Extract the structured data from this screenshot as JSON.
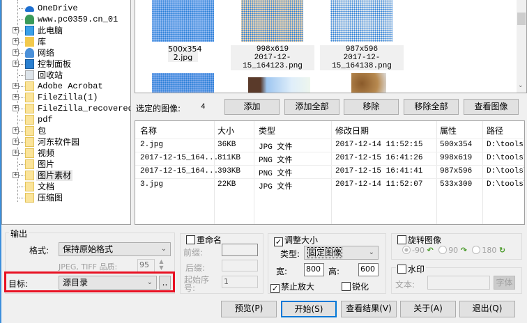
{
  "tree": [
    {
      "label": "OneDrive",
      "expandable": false,
      "icon": "onedrive-icon"
    },
    {
      "label": "www.pc0359.cn_01",
      "expandable": false,
      "icon": "user-icon"
    },
    {
      "label": "此电脑",
      "expandable": true,
      "icon": "computer-icon"
    },
    {
      "label": "库",
      "expandable": true,
      "icon": "library-icon"
    },
    {
      "label": "网络",
      "expandable": true,
      "icon": "network-icon"
    },
    {
      "label": "控制面板",
      "expandable": true,
      "icon": "control-panel-icon"
    },
    {
      "label": "回收站",
      "expandable": false,
      "icon": "recycle-bin-icon"
    },
    {
      "label": "Adobe Acrobat",
      "expandable": true,
      "icon": "folder-icon"
    },
    {
      "label": "FileZilla(1)",
      "expandable": true,
      "icon": "folder-icon"
    },
    {
      "label": "FileZilla_recovered",
      "expandable": true,
      "icon": "folder-icon"
    },
    {
      "label": "pdf",
      "expandable": false,
      "icon": "folder-icon"
    },
    {
      "label": "包",
      "expandable": true,
      "icon": "folder-icon"
    },
    {
      "label": "河东软件园",
      "expandable": true,
      "icon": "folder-icon"
    },
    {
      "label": "视频",
      "expandable": true,
      "icon": "folder-icon"
    },
    {
      "label": "图片",
      "expandable": false,
      "icon": "folder-icon"
    },
    {
      "label": "图片素材",
      "expandable": true,
      "icon": "folder-icon",
      "selected": true
    },
    {
      "label": "文档",
      "expandable": false,
      "icon": "folder-icon"
    },
    {
      "label": "压缩图",
      "expandable": false,
      "icon": "folder-icon"
    }
  ],
  "thumbnails": [
    {
      "size": "500x354",
      "name": "2.jpg"
    },
    {
      "size": "998x619",
      "name": "2017-12-15_164123.png"
    },
    {
      "size": "987x596",
      "name": "2017-12-15_164138.png"
    }
  ],
  "selection": {
    "label": "选定的图像:",
    "count": "4"
  },
  "actions": {
    "add": "添加",
    "add_all": "添加全部",
    "remove": "移除",
    "remove_all": "移除全部",
    "view": "查看图像"
  },
  "list": {
    "headers": [
      "名称",
      "大小",
      "类型",
      "修改日期",
      "属性",
      "路径"
    ],
    "rows": [
      [
        "2.jpg",
        "36KB",
        "JPG 文件",
        "2017-12-14 11:52:15",
        "500x354",
        "D:\\tools\\"
      ],
      [
        "2017-12-15_164...",
        "811KB",
        "PNG 文件",
        "2017-12-15 16:41:26",
        "998x619",
        "D:\\tools\\"
      ],
      [
        "2017-12-15_164...",
        "393KB",
        "PNG 文件",
        "2017-12-15 16:41:41",
        "987x596",
        "D:\\tools\\"
      ],
      [
        "3.jpg",
        "22KB",
        "JPG 文件",
        "2017-12-14 11:52:07",
        "533x300",
        "D:\\tools\\"
      ]
    ]
  },
  "output": {
    "title": "输出",
    "format_label": "格式:",
    "format_value": "保持原始格式",
    "quality_label": "JPEG, TIFF 品质:",
    "quality_value": "95",
    "target_label": "目标:",
    "target_value": "源目录",
    "browse": ".."
  },
  "rename": {
    "title": "重命名",
    "prefix": "前缀:",
    "suffix": "后缀:",
    "start": "起始序号:",
    "start_value": "1"
  },
  "resize": {
    "title": "调整大小",
    "type_label": "类型:",
    "type_value": "固定图像",
    "width_label": "宽:",
    "width_value": "800",
    "height_label": "高:",
    "height_value": "600",
    "no_enlarge": "禁止放大",
    "sharpen": "锐化"
  },
  "rotate": {
    "title": "旋转图像",
    "opts": [
      "-90",
      "90",
      "180"
    ]
  },
  "watermark": {
    "title": "水印",
    "text_label": "文本:",
    "font_btn": "字体"
  },
  "footer": {
    "preview": "预览(P)",
    "start": "开始(S)",
    "results": "查看结果(V)",
    "about": "关于(A)",
    "exit": "退出(Q)"
  },
  "colors": {
    "highlight": "#e81123",
    "accent": "#0078d7"
  }
}
